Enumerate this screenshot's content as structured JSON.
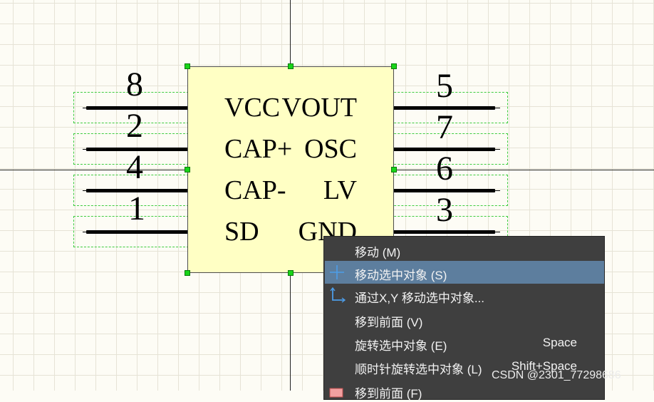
{
  "pins_left": [
    {
      "number": "8",
      "name": "VCC"
    },
    {
      "number": "2",
      "name": "CAP+"
    },
    {
      "number": "4",
      "name": "CAP-"
    },
    {
      "number": "1",
      "name": "SD"
    }
  ],
  "pins_right": [
    {
      "number": "5",
      "name": "VOUT"
    },
    {
      "number": "7",
      "name": "OSC"
    },
    {
      "number": "6",
      "name": "LV"
    },
    {
      "number": "3",
      "name": "GND"
    }
  ],
  "context_menu": {
    "items": [
      {
        "label": "移动 (M)",
        "shortcut": "",
        "icon": "",
        "selected": false
      },
      {
        "label": "移动选中对象 (S)",
        "shortcut": "",
        "icon": "move-crosshair-icon",
        "selected": true
      },
      {
        "label": "通过X,Y 移动选中对象...",
        "shortcut": "",
        "icon": "xy-axes-icon",
        "selected": false
      },
      {
        "label": "移到前面 (V)",
        "shortcut": "",
        "icon": "",
        "selected": false
      },
      {
        "label": "旋转选中对象 (E)",
        "shortcut": "Space",
        "icon": "",
        "selected": false
      },
      {
        "label": "顺时针旋转选中对象 (L)",
        "shortcut": "Shift+Space",
        "icon": "",
        "selected": false
      },
      {
        "label": "移到前面 (F)",
        "shortcut": "",
        "icon": "bring-front-icon",
        "selected": false
      }
    ]
  },
  "colors": {
    "canvas": "#fdfcf5",
    "component_body": "#ffffc4",
    "selection_handle": "#19d419",
    "menu_bg": "#3f3f3f",
    "menu_highlight": "#5d7e9e"
  },
  "watermark": "CSDN @2301_77298686"
}
